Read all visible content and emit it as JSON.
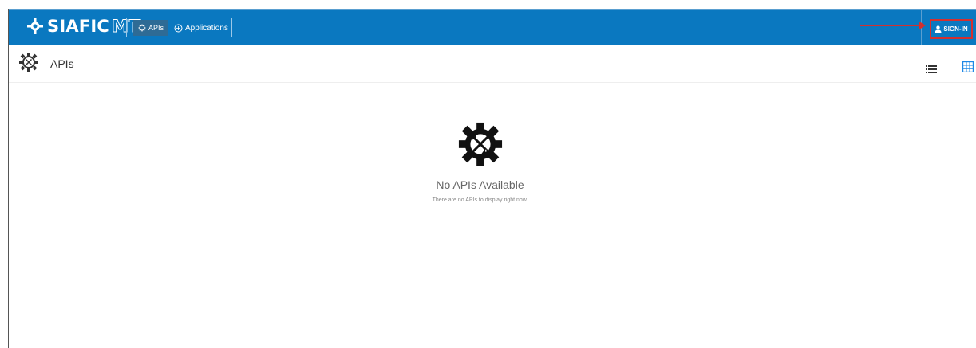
{
  "brand": {
    "name": "SIAFIC",
    "suffix": "MT"
  },
  "nav": {
    "apis_label": "APIs",
    "applications_label": "Applications"
  },
  "auth": {
    "signin_label": "SIGN-IN"
  },
  "page": {
    "title": "APIs"
  },
  "empty_state": {
    "title": "No APIs Available",
    "subtitle": "There are no APIs to display right now."
  },
  "colors": {
    "topbar": "#0a78c0",
    "active_tab": "#2e6b95",
    "highlight": "#d32f2f",
    "grid_icon": "#1e88e5"
  }
}
